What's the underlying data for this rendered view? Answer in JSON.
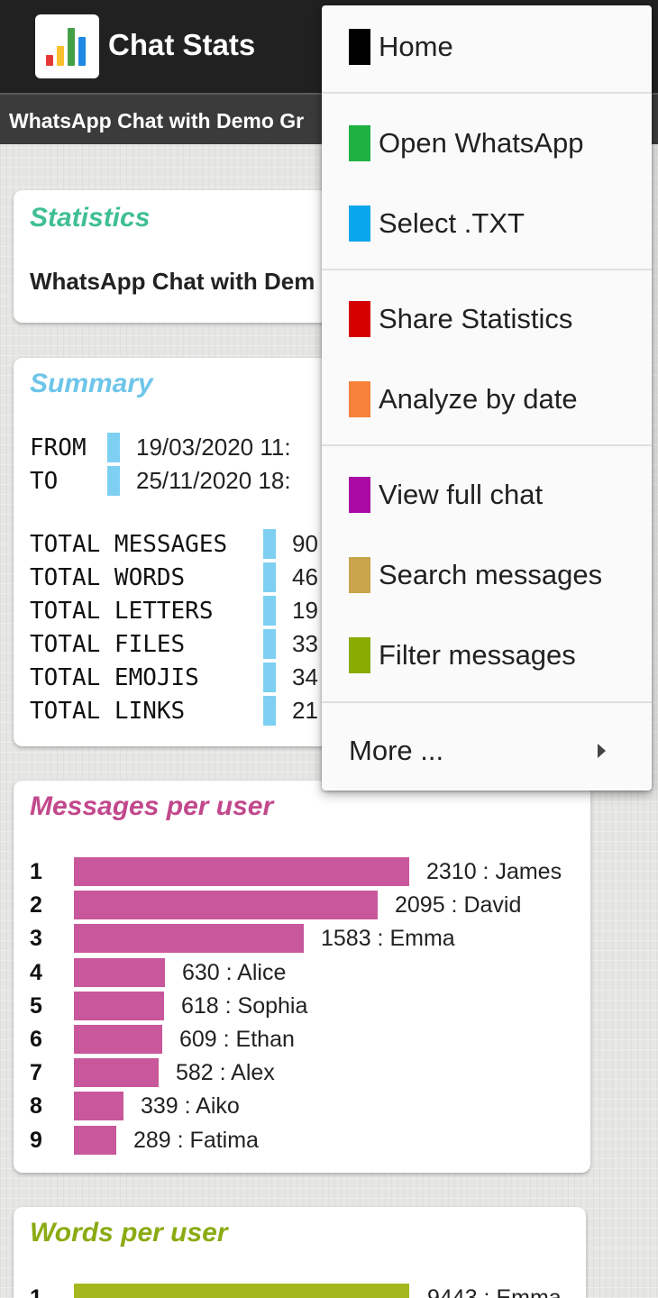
{
  "app": {
    "title": "Chat Stats",
    "subtitle": "WhatsApp Chat with Demo Gr",
    "logo_bar_colors": [
      "#e53935",
      "#fbc02d",
      "#43a047",
      "#1e88e5"
    ],
    "logo_icon": "bar-chart-logo-icon"
  },
  "statistics_card": {
    "title": "Statistics",
    "title_color": "#3fbf93",
    "chat_name": "WhatsApp Chat with Dem"
  },
  "summary_card": {
    "title": "Summary",
    "title_color": "#6ec5e9",
    "accent_color": "#7ed0f2",
    "from_label": "FROM",
    "from_value": "19/03/2020 11:",
    "to_label": "TO",
    "to_value": "25/11/2020 18:",
    "totals": [
      {
        "label": "TOTAL MESSAGES",
        "value": "90"
      },
      {
        "label": "TOTAL WORDS",
        "value": "46"
      },
      {
        "label": "TOTAL LETTERS",
        "value": "19"
      },
      {
        "label": "TOTAL FILES",
        "value": "33"
      },
      {
        "label": "TOTAL EMOJIS",
        "value": "34"
      },
      {
        "label": "TOTAL LINKS",
        "value": "21"
      }
    ]
  },
  "messages_card": {
    "title": "Messages per user",
    "title_color": "#c2488c",
    "bar_color": "#c9579b"
  },
  "words_card": {
    "title": "Words per user",
    "title_color": "#8aab12",
    "bar_color": "#a4b71e",
    "first_rank": "1",
    "first_label": "9443 : Emma"
  },
  "chart_data": {
    "type": "bar",
    "orientation": "horizontal",
    "title": "Messages per user",
    "categories": [
      "James",
      "David",
      "Emma",
      "Alice",
      "Sophia",
      "Ethan",
      "Alex",
      "Aiko",
      "Fatima"
    ],
    "ranks": [
      "1",
      "2",
      "3",
      "4",
      "5",
      "6",
      "7",
      "8",
      "9"
    ],
    "values": [
      2310,
      2095,
      1583,
      630,
      618,
      609,
      582,
      339,
      289
    ],
    "labels": [
      "2310 : James",
      "2095 : David",
      "1583 : Emma",
      "630 : Alice",
      "618 : Sophia",
      "609 : Ethan",
      "582 : Alex",
      "339 : Aiko",
      "289 : Fatima"
    ]
  },
  "menu": {
    "items": [
      {
        "label": "Home",
        "color": "#000000"
      },
      {
        "label": "Open WhatsApp",
        "color": "#1fb141"
      },
      {
        "label": "Select .TXT",
        "color": "#0aa6eb"
      },
      {
        "label": "Share Statistics",
        "color": "#d50000"
      },
      {
        "label": "Analyze by date",
        "color": "#f5813a"
      },
      {
        "label": "View full chat",
        "color": "#a90aa4"
      },
      {
        "label": "Search messages",
        "color": "#c8a44a"
      },
      {
        "label": "Filter messages",
        "color": "#8aab00"
      }
    ],
    "more_label": "More ...",
    "more_icon": "chevron-right-icon"
  }
}
